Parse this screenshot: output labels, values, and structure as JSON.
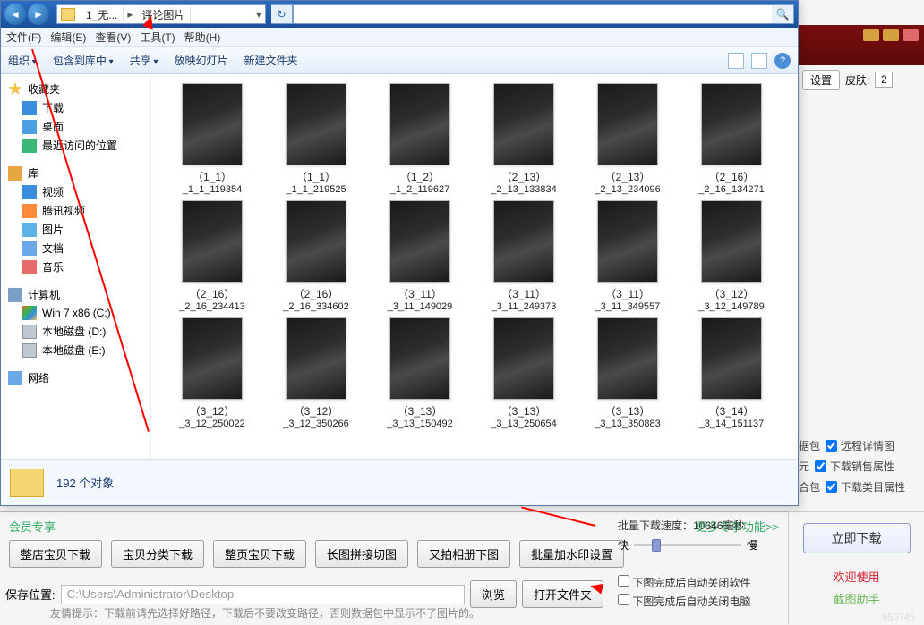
{
  "explorer": {
    "crumb1": "1_无...",
    "crumb2": "评论图片",
    "search_placeholder": "",
    "menu": [
      "文件(F)",
      "编辑(E)",
      "查看(V)",
      "工具(T)",
      "帮助(H)"
    ],
    "toolbar": {
      "org": "组织",
      "lib": "包含到库中",
      "share": "共享",
      "slide": "放映幻灯片",
      "new": "新建文件夹"
    },
    "side": {
      "fav": "收藏夹",
      "dl": "下载",
      "desk": "桌面",
      "rec": "最近访问的位置",
      "lib": "库",
      "vid": "视频",
      "tx": "腾讯视频",
      "img": "图片",
      "doc": "文档",
      "mus": "音乐",
      "pc": "计算机",
      "win": "Win 7 x86 (C:)",
      "d": "本地磁盘 (D:)",
      "e": "本地磁盘 (E:)",
      "net": "网络"
    },
    "status": "192 个对象"
  },
  "files": [
    {
      "a": "（1_1）",
      "b": "_1_1_119354"
    },
    {
      "a": "（1_1）",
      "b": "_1_1_219525"
    },
    {
      "a": "（1_2）",
      "b": "_1_2_119627"
    },
    {
      "a": "（2_13）",
      "b": "_2_13_133834"
    },
    {
      "a": "（2_13）",
      "b": "_2_13_234096"
    },
    {
      "a": "（2_16）",
      "b": "_2_16_134271"
    },
    {
      "a": "（2_16）",
      "b": "_2_16_234413"
    },
    {
      "a": "（2_16）",
      "b": "_2_16_334602"
    },
    {
      "a": "（3_11）",
      "b": "_3_11_149029"
    },
    {
      "a": "（3_11）",
      "b": "_3_11_249373"
    },
    {
      "a": "（3_11）",
      "b": "_3_11_349557"
    },
    {
      "a": "（3_12）",
      "b": "_3_12_149789"
    },
    {
      "a": "（3_12）",
      "b": "_3_12_250022"
    },
    {
      "a": "（3_12）",
      "b": "_3_12_350266"
    },
    {
      "a": "（3_13）",
      "b": "_3_13_150492"
    },
    {
      "a": "（3_13）",
      "b": "_3_13_250654"
    },
    {
      "a": "（3_13）",
      "b": "_3_13_350883"
    },
    {
      "a": "（3_14）",
      "b": "_3_14_151137"
    }
  ],
  "back": {
    "settings": "设置",
    "skin": "皮肤:",
    "skin_val": "2"
  },
  "rightopts": {
    "pack": "据包",
    "unit": "元",
    "combo": "合包",
    "remote": "远程详情图",
    "sale": "下载销售属性",
    "cat": "下载类目属性"
  },
  "panel": {
    "member": "会员专享",
    "more": "更多专享功能>>",
    "speed": "批量下载速度：10646毫秒",
    "btns": [
      "整店宝贝下载",
      "宝贝分类下载",
      "整页宝贝下载",
      "长图拼接切图",
      "又拍相册下图",
      "批量加水印设置"
    ],
    "fast": "快",
    "slow": "慢",
    "chk1": "下图完成后自动关闭软件",
    "chk2": "下图完成后自动关闭电脑",
    "save": "保存位置:",
    "path": "C:\\Users\\Administrator\\Desktop",
    "browse": "浏览",
    "open": "打开文件夹",
    "hint": "友情提示：下载前请先选择好路径，下载后不要改变路径，否则数据包中显示不了图片的。",
    "download": "立即下载",
    "welcome": "欢迎使用",
    "tool": "截图助手"
  },
  "watermark": "950745"
}
